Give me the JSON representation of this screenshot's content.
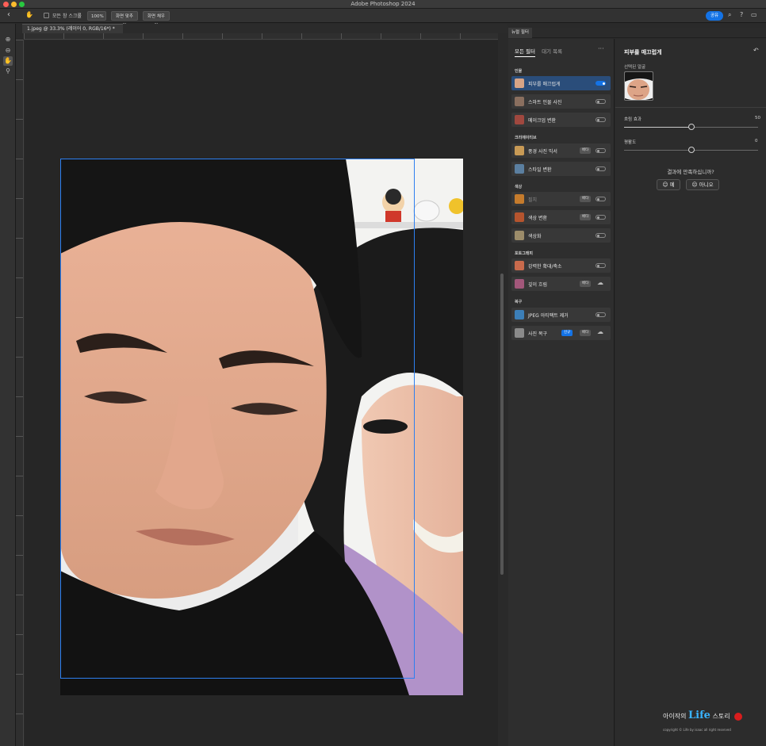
{
  "window": {
    "title": "Adobe Photoshop 2024"
  },
  "options_bar": {
    "scroll_all_label": "모든 창 스크롤",
    "zoom_100": "100%",
    "fit_screen": "화면 맞추기",
    "fill_screen": "화면 채우기",
    "share_label": "공유"
  },
  "document": {
    "tab_label": "1.jpeg @ 33.3% (레이어 0, RGB/16*) *"
  },
  "panel": {
    "tab_label": "뉴럴 필터"
  },
  "filters": {
    "tabs": [
      "모든 필터",
      "대기 목록"
    ],
    "more": "···",
    "sections": [
      {
        "title": "인물",
        "items": [
          {
            "label": "피부를 매끄럽게",
            "toggle": "on",
            "selected": true
          },
          {
            "label": "스마트 인물 사진",
            "toggle": "off"
          },
          {
            "label": "메이크업 변환",
            "toggle": "off"
          }
        ]
      },
      {
        "title": "크리에이티브",
        "items": [
          {
            "label": "풍경 사진 믹서",
            "badge": "베타",
            "toggle": "off"
          },
          {
            "label": "스타일 변환",
            "toggle": "off"
          }
        ]
      },
      {
        "title": "색상",
        "items": [
          {
            "label": "필치",
            "badge": "베타",
            "toggle": "off",
            "dim": true
          },
          {
            "label": "색상 변환",
            "badge": "베타",
            "toggle": "off"
          },
          {
            "label": "색상화",
            "toggle": "off"
          }
        ]
      },
      {
        "title": "포토그래피",
        "items": [
          {
            "label": "강력한 확대/축소",
            "toggle": "off"
          },
          {
            "label": "깊이 흐림",
            "badge": "베타",
            "cloud": true
          }
        ]
      },
      {
        "title": "복구",
        "items": [
          {
            "label": "JPEG 아티팩트 제거",
            "toggle": "off"
          },
          {
            "label": "사진 복구",
            "badge_new": "신규",
            "badge": "베타",
            "cloud": true
          }
        ]
      }
    ]
  },
  "settings": {
    "title": "피부를 매끄럽게",
    "selected_face_label": "선택된 얼굴",
    "blur_label": "흐림 효과",
    "blur_value": "50",
    "blur_fraction": 0.5,
    "smoothness_label": "평활도",
    "smoothness_value": "0",
    "smoothness_fraction": 0.5,
    "question": "결과에 만족하십니까?",
    "yes_label": "예",
    "no_label": "아니오"
  },
  "watermark": {
    "prefix": "아이작의",
    "brand": "Life",
    "suffix": "스토리",
    "copyright": "copyright © Life by isaac all right reserved"
  }
}
